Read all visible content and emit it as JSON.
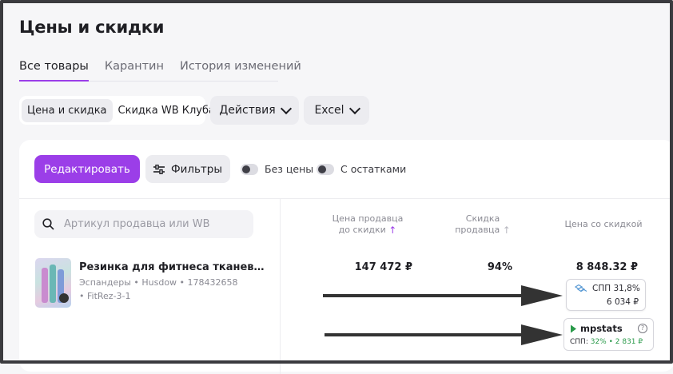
{
  "page": {
    "title": "Цены и скидки"
  },
  "tabs": [
    {
      "label": "Все товары",
      "active": true
    },
    {
      "label": "Карантин",
      "active": false
    },
    {
      "label": "История изменений",
      "active": false
    }
  ],
  "segment": {
    "options": [
      "Цена и скидка",
      "Скидка WB Клуба"
    ],
    "selected": "Цена и скидка"
  },
  "dropdowns": {
    "actions": "Действия",
    "excel": "Excel"
  },
  "toolbar": {
    "edit_label": "Редактировать",
    "filters_label": "Фильтры",
    "toggle_no_price": "Без цены",
    "toggle_with_stock": "С остатками"
  },
  "search": {
    "placeholder": "Артикул продавца или WB"
  },
  "columns": {
    "seller_price": [
      "Цена продавца",
      "до скидки"
    ],
    "seller_discount": [
      "Скидка",
      "продавца"
    ],
    "discounted_price": "Цена со скидкой"
  },
  "product": {
    "title": "Резинка для фитнеса тканевая (+...",
    "meta": "Эспандеры • Husdow • 178432658",
    "article": "• FitRez-3-1",
    "price": "147 472 ₽",
    "discount": "94%",
    "discounted_price": "8 848.32 ₽"
  },
  "spp_card": {
    "label": "СПП 31,8%",
    "price": "6 034 ₽"
  },
  "mpstats_card": {
    "brand": "mpstats",
    "help": "?",
    "spp_label": "СПП:",
    "spp_value": "32% • 2 831 ₽"
  },
  "colors": {
    "accent": "#9b3ee8",
    "mpstats_green": "#2a9a4a"
  },
  "icons": [
    "search-icon",
    "filter-sliders-icon",
    "chevron-down-icon",
    "sort-arrow-up-icon",
    "wb-logo-icon",
    "mpstats-logo-icon",
    "help-icon"
  ]
}
